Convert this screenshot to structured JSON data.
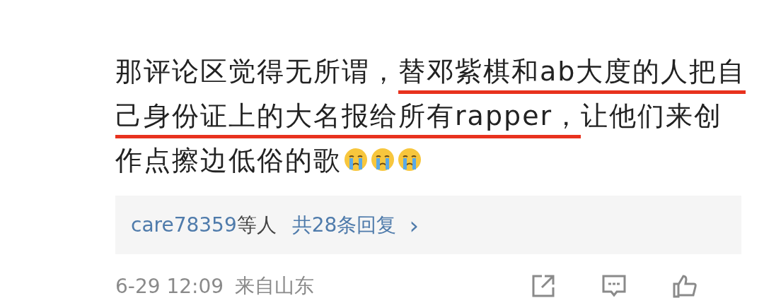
{
  "comment": {
    "segments": [
      {
        "text": "那评论区觉得无所谓，",
        "underlined": false
      },
      {
        "text": "替邓紫棋和ab大度的人把自己身份证上的大名报给所有rapper，",
        "underlined": true
      },
      {
        "text": "让他们来创作点擦边低俗的歌",
        "underlined": false
      }
    ],
    "emojis": [
      {
        "kind": "crying"
      },
      {
        "kind": "crying"
      },
      {
        "kind": "crying"
      }
    ]
  },
  "replies": {
    "users": "care78359",
    "suffix": "等人",
    "link": "共28条回复",
    "arrow": "›"
  },
  "footer": {
    "time": "6-29 12:09",
    "location": "来自山东",
    "actions": [
      {
        "kind": "share"
      },
      {
        "kind": "comment"
      },
      {
        "kind": "like"
      }
    ]
  }
}
